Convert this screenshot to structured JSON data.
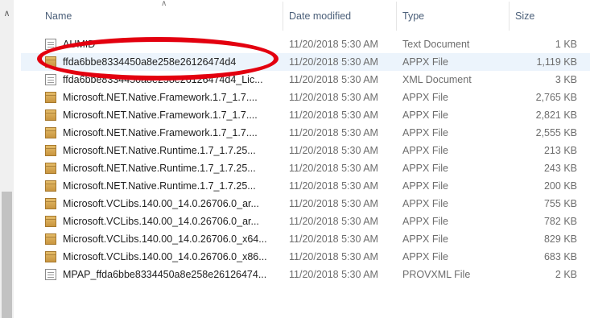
{
  "columns": {
    "name": "Name",
    "date": "Date modified",
    "type": "Type",
    "size": "Size"
  },
  "rows": [
    {
      "name": "AUMID",
      "date": "11/20/2018 5:30 AM",
      "type": "Text Document",
      "size": "1 KB",
      "icon": "text-document-icon"
    },
    {
      "name": "ffda6bbe8334450a8e258e26126474d4",
      "date": "11/20/2018 5:30 AM",
      "type": "APPX File",
      "size": "1,119 KB",
      "icon": "package-icon"
    },
    {
      "name": "ffda6bbe8334450a8e258e26126474d4_Lic...",
      "date": "11/20/2018 5:30 AM",
      "type": "XML Document",
      "size": "3 KB",
      "icon": "xml-document-icon"
    },
    {
      "name": "Microsoft.NET.Native.Framework.1.7_1.7....",
      "date": "11/20/2018 5:30 AM",
      "type": "APPX File",
      "size": "2,765 KB",
      "icon": "package-icon"
    },
    {
      "name": "Microsoft.NET.Native.Framework.1.7_1.7....",
      "date": "11/20/2018 5:30 AM",
      "type": "APPX File",
      "size": "2,821 KB",
      "icon": "package-icon"
    },
    {
      "name": "Microsoft.NET.Native.Framework.1.7_1.7....",
      "date": "11/20/2018 5:30 AM",
      "type": "APPX File",
      "size": "2,555 KB",
      "icon": "package-icon"
    },
    {
      "name": "Microsoft.NET.Native.Runtime.1.7_1.7.25...",
      "date": "11/20/2018 5:30 AM",
      "type": "APPX File",
      "size": "213 KB",
      "icon": "package-icon"
    },
    {
      "name": "Microsoft.NET.Native.Runtime.1.7_1.7.25...",
      "date": "11/20/2018 5:30 AM",
      "type": "APPX File",
      "size": "243 KB",
      "icon": "package-icon"
    },
    {
      "name": "Microsoft.NET.Native.Runtime.1.7_1.7.25...",
      "date": "11/20/2018 5:30 AM",
      "type": "APPX File",
      "size": "200 KB",
      "icon": "package-icon"
    },
    {
      "name": "Microsoft.VCLibs.140.00_14.0.26706.0_ar...",
      "date": "11/20/2018 5:30 AM",
      "type": "APPX File",
      "size": "755 KB",
      "icon": "package-icon"
    },
    {
      "name": "Microsoft.VCLibs.140.00_14.0.26706.0_ar...",
      "date": "11/20/2018 5:30 AM",
      "type": "APPX File",
      "size": "782 KB",
      "icon": "package-icon"
    },
    {
      "name": "Microsoft.VCLibs.140.00_14.0.26706.0_x64...",
      "date": "11/20/2018 5:30 AM",
      "type": "APPX File",
      "size": "829 KB",
      "icon": "package-icon"
    },
    {
      "name": "Microsoft.VCLibs.140.00_14.0.26706.0_x86...",
      "date": "11/20/2018 5:30 AM",
      "type": "APPX File",
      "size": "683 KB",
      "icon": "package-icon"
    },
    {
      "name": "MPAP_ffda6bbe8334450a8e258e26126474...",
      "date": "11/20/2018 5:30 AM",
      "type": "PROVXML File",
      "size": "2 KB",
      "icon": "document-icon"
    }
  ],
  "selected_row": 1,
  "colors": {
    "header_text": "#4c607a",
    "selection": "#ecf4fc",
    "annotation": "#e3000f"
  }
}
